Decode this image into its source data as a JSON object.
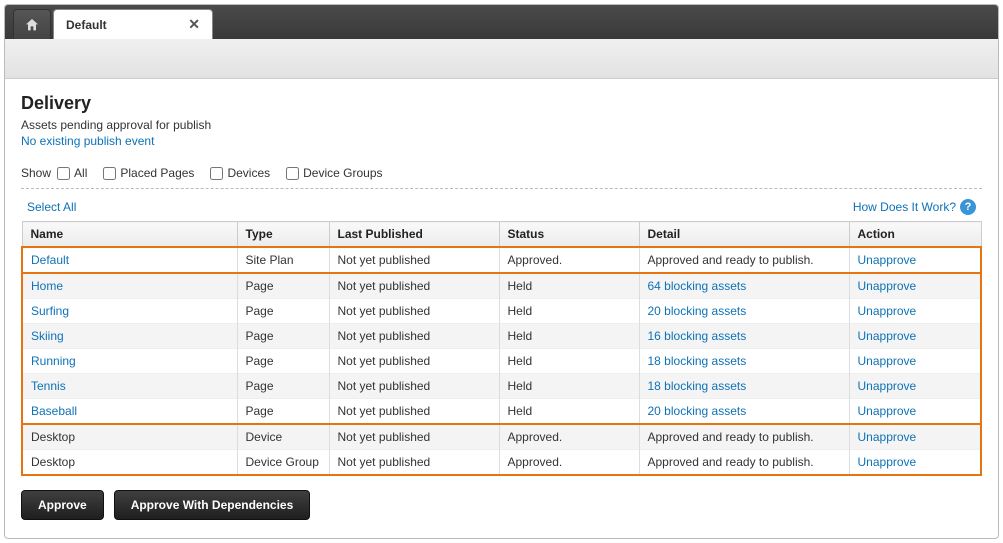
{
  "tab": {
    "label": "Default"
  },
  "section": {
    "title": "Delivery",
    "subtitle": "Assets pending approval for publish",
    "event_link": "No existing publish event"
  },
  "filters": {
    "label": "Show",
    "all": "All",
    "placed_pages": "Placed Pages",
    "devices": "Devices",
    "device_groups": "Device Groups"
  },
  "meta": {
    "select_all": "Select All",
    "help": "How Does It Work?"
  },
  "columns": {
    "name": "Name",
    "type": "Type",
    "last": "Last Published",
    "status": "Status",
    "detail": "Detail",
    "action": "Action"
  },
  "rows": [
    {
      "name": "Default",
      "name_link": true,
      "type": "Site Plan",
      "last": "Not yet published",
      "status": "Approved.",
      "detail": "Approved and ready to publish.",
      "detail_link": false,
      "action": "Unapprove",
      "zebra": false,
      "hl_top": true,
      "grp_sep": false
    },
    {
      "name": "Home",
      "name_link": true,
      "type": "Page",
      "last": "Not yet published",
      "status": "Held",
      "detail": "64 blocking assets",
      "detail_link": true,
      "action": "Unapprove",
      "zebra": true,
      "hl_top": false,
      "grp_sep": true
    },
    {
      "name": "Surfing",
      "name_link": true,
      "type": "Page",
      "last": "Not yet published",
      "status": "Held",
      "detail": "20 blocking assets",
      "detail_link": true,
      "action": "Unapprove",
      "zebra": false,
      "hl_top": false,
      "grp_sep": false
    },
    {
      "name": "Skiing",
      "name_link": true,
      "type": "Page",
      "last": "Not yet published",
      "status": "Held",
      "detail": "16 blocking assets",
      "detail_link": true,
      "action": "Unapprove",
      "zebra": true,
      "hl_top": false,
      "grp_sep": false
    },
    {
      "name": "Running",
      "name_link": true,
      "type": "Page",
      "last": "Not yet published",
      "status": "Held",
      "detail": "18 blocking assets",
      "detail_link": true,
      "action": "Unapprove",
      "zebra": false,
      "hl_top": false,
      "grp_sep": false
    },
    {
      "name": "Tennis",
      "name_link": true,
      "type": "Page",
      "last": "Not yet published",
      "status": "Held",
      "detail": "18 blocking assets",
      "detail_link": true,
      "action": "Unapprove",
      "zebra": true,
      "hl_top": false,
      "grp_sep": false
    },
    {
      "name": "Baseball",
      "name_link": true,
      "type": "Page",
      "last": "Not yet published",
      "status": "Held",
      "detail": "20 blocking assets",
      "detail_link": true,
      "action": "Unapprove",
      "zebra": false,
      "hl_top": false,
      "grp_sep": false
    },
    {
      "name": "Desktop",
      "name_link": false,
      "type": "Device",
      "last": "Not yet published",
      "status": "Approved.",
      "detail": "Approved and ready to publish.",
      "detail_link": false,
      "action": "Unapprove",
      "zebra": true,
      "hl_top": false,
      "grp_sep": true
    },
    {
      "name": "Desktop",
      "name_link": false,
      "type": "Device Group",
      "last": "Not yet published",
      "status": "Approved.",
      "detail": "Approved and ready to publish.",
      "detail_link": false,
      "action": "Unapprove",
      "zebra": false,
      "hl_top": false,
      "hl_bottom": true,
      "grp_sep": false
    }
  ],
  "buttons": {
    "approve": "Approve",
    "approve_deps": "Approve With Dependencies"
  }
}
